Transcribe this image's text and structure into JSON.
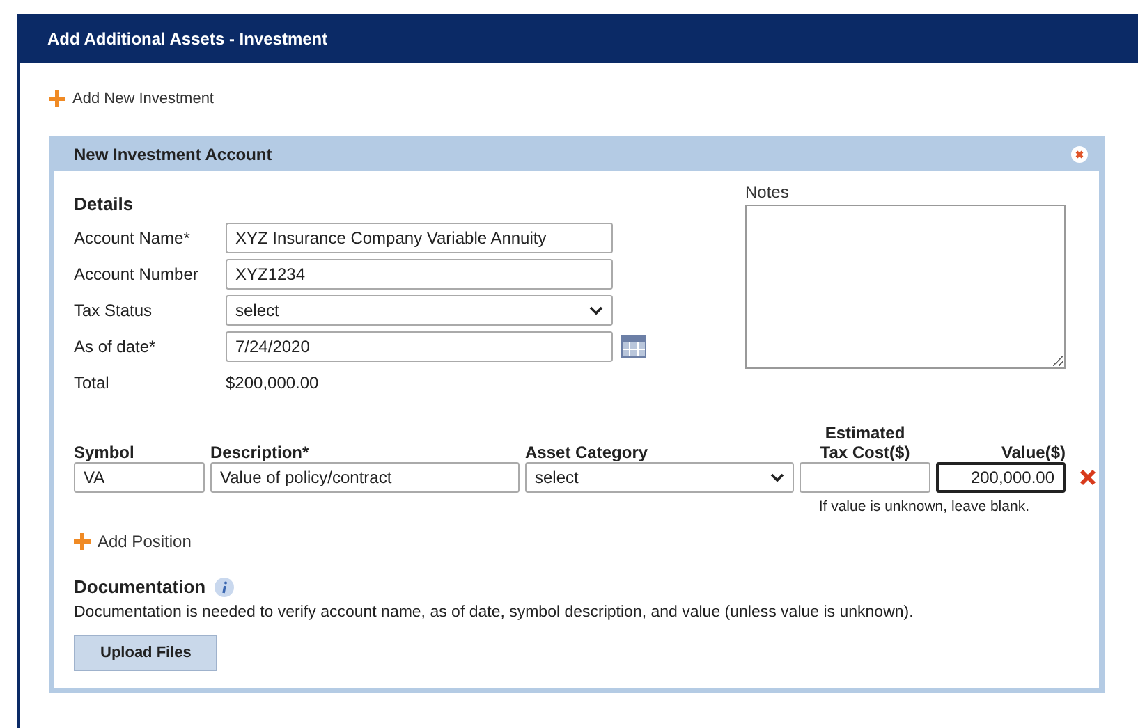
{
  "window": {
    "title": "Add Additional Assets - Investment"
  },
  "add_investment_link": "Add New Investment",
  "panel": {
    "title": "New Investment Account",
    "details_heading": "Details",
    "fields": [
      {
        "kind": "text",
        "label": "Account Name*",
        "value": "XYZ Insurance Company Variable Annuity"
      },
      {
        "kind": "text",
        "label": "Account Number",
        "value": "XYZ1234"
      },
      {
        "kind": "select",
        "label": "Tax Status",
        "value": "select"
      },
      {
        "kind": "date",
        "label": "As of date*",
        "value": "7/24/2020"
      },
      {
        "kind": "static",
        "label": "Total",
        "value": "$200,000.00"
      }
    ],
    "notes": {
      "label": "Notes"
    },
    "positions": {
      "columns": [
        "Symbol",
        "Description*",
        "Asset Category",
        "Estimated Tax Cost($)",
        "Value($)"
      ],
      "rows": [
        {
          "symbol": "VA",
          "description": "Value of policy/contract",
          "asset_category": "select",
          "value": "200,000.00",
          "value_focused": true
        }
      ],
      "hint": "If value is unknown, leave blank."
    },
    "add_position_link": "Add Position",
    "documentation": {
      "heading": "Documentation",
      "text": "Documentation is needed to verify account name, as of date, symbol description, and value (unless value is unknown).",
      "upload_button": "Upload Files"
    }
  }
}
